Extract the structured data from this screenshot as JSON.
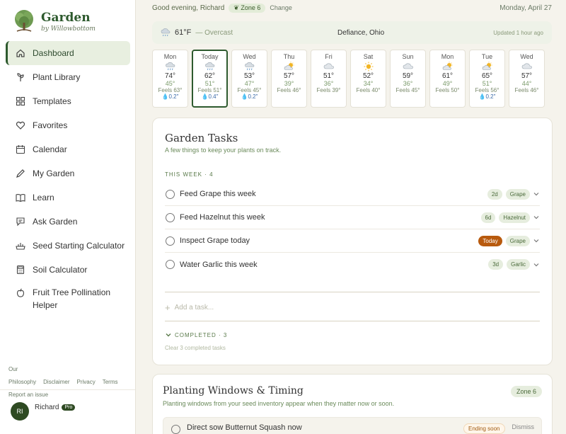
{
  "brand": {
    "title": "Garden",
    "subtitle": "by Willowbottom"
  },
  "nav": [
    {
      "label": "Dashboard",
      "icon": "home-icon",
      "active": true
    },
    {
      "label": "Plant Library",
      "icon": "sprout-icon"
    },
    {
      "label": "Templates",
      "icon": "grid-icon"
    },
    {
      "label": "Favorites",
      "icon": "heart-icon"
    },
    {
      "label": "Calendar",
      "icon": "calendar-icon"
    },
    {
      "label": "My Garden",
      "icon": "pencil-icon"
    },
    {
      "label": "Learn",
      "icon": "book-icon"
    },
    {
      "label": "Ask Garden",
      "icon": "chat-icon"
    },
    {
      "label": "Seed Starting Calculator",
      "icon": "seed-tray-icon"
    },
    {
      "label": "Soil Calculator",
      "icon": "calculator-icon"
    },
    {
      "label": "Fruit Tree Pollination Helper",
      "icon": "apple-icon"
    }
  ],
  "footer_links": [
    "Our Philosophy",
    "Disclaimer",
    "Privacy",
    "Terms",
    "Report an issue"
  ],
  "user": {
    "initials": "RI",
    "name": "Richard",
    "badge": "Pro"
  },
  "topbar": {
    "greeting": "Good evening, Richard",
    "zone": "Zone 6",
    "change": "Change",
    "date": "Monday, April 27"
  },
  "weather": {
    "temp": "61°F",
    "condition": "— Overcast",
    "location": "Defiance, Ohio",
    "updated": "Updated 1 hour ago"
  },
  "forecast": [
    {
      "day": "Mon",
      "icon": "rain-icon",
      "hi": "74°",
      "lo": "45°",
      "feels": "Feels 63°",
      "precip": "0.2\""
    },
    {
      "day": "Today",
      "icon": "rain-icon",
      "hi": "62°",
      "lo": "51°",
      "feels": "Feels 51°",
      "precip": "0.4\"",
      "today": true
    },
    {
      "day": "Wed",
      "icon": "rain-icon",
      "hi": "53°",
      "lo": "47°",
      "feels": "Feels 45°",
      "precip": "0.2\""
    },
    {
      "day": "Thu",
      "icon": "partly-sunny-icon",
      "hi": "57°",
      "lo": "39°",
      "feels": "Feels 46°",
      "precip": ""
    },
    {
      "day": "Fri",
      "icon": "cloud-icon",
      "hi": "51°",
      "lo": "36°",
      "feels": "Feels 39°",
      "precip": ""
    },
    {
      "day": "Sat",
      "icon": "sun-icon",
      "hi": "52°",
      "lo": "34°",
      "feels": "Feels 40°",
      "precip": ""
    },
    {
      "day": "Sun",
      "icon": "cloud-icon",
      "hi": "59°",
      "lo": "36°",
      "feels": "Feels 45°",
      "precip": ""
    },
    {
      "day": "Mon",
      "icon": "partly-sunny-icon",
      "hi": "61°",
      "lo": "49°",
      "feels": "Feels 50°",
      "precip": ""
    },
    {
      "day": "Tue",
      "icon": "partly-sunny-icon",
      "hi": "65°",
      "lo": "51°",
      "feels": "Feels 56°",
      "precip": "0.2\""
    },
    {
      "day": "Wed",
      "icon": "cloud-icon",
      "hi": "57°",
      "lo": "44°",
      "feels": "Feels 46°",
      "precip": ""
    }
  ],
  "tasks": {
    "title": "Garden Tasks",
    "subtitle": "A few things to keep your plants on track.",
    "section": "THIS WEEK · 4",
    "items": [
      {
        "text": "Feed Grape this week",
        "due": "2d",
        "plant": "Grape"
      },
      {
        "text": "Feed Hazelnut this week",
        "due": "6d",
        "plant": "Hazelnut"
      },
      {
        "text": "Inspect Grape today",
        "due": "Today",
        "plant": "Grape",
        "urgent": true
      },
      {
        "text": "Water Garlic this week",
        "due": "3d",
        "plant": "Garlic"
      }
    ],
    "add_placeholder": "Add a task...",
    "completed": "COMPLETED · 3",
    "clear": "Clear 3 completed tasks"
  },
  "planting": {
    "title": "Planting Windows & Timing",
    "subtitle": "Planting windows from your seed inventory appear when they matter now or soon.",
    "zone": "Zone 6",
    "row": {
      "text": "Direct sow Butternut Squash now",
      "status": "Ending soon",
      "dismiss": "Dismiss"
    }
  },
  "colors": {
    "accent": "#2e5a2e",
    "urgent": "#b85a0e",
    "chip_bg": "#e6edde"
  }
}
